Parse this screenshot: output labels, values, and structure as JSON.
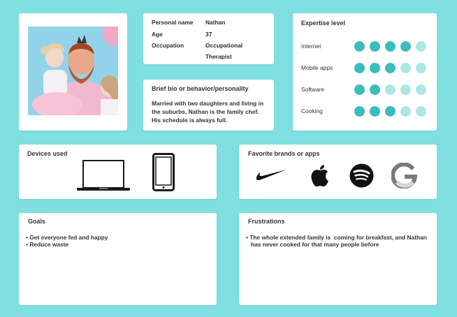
{
  "persona": {
    "name_label": "Personal name",
    "name_value": "Nathan",
    "age_label": "Age",
    "age_value": "37",
    "occupation_label": "Occupation",
    "occupation_value": "Occupational Therapist"
  },
  "bio": {
    "title": "Brief bio or behavior/personality",
    "text": "Married with two daughters and living in the suburbs, Nathan is the family chef. His schedule is always full."
  },
  "expertise": {
    "title": "Expertise level",
    "max": 5,
    "items": [
      {
        "label": "Internet",
        "level": 4
      },
      {
        "label": "Mobile apps",
        "level": 3
      },
      {
        "label": "Software",
        "level": 2
      },
      {
        "label": "Cooking",
        "level": 3
      }
    ],
    "colors": {
      "filled": "#3bbcbd",
      "empty": "#aee6e7"
    }
  },
  "devices": {
    "title": "Devices used",
    "items": [
      "laptop-icon",
      "smartphone-icon"
    ]
  },
  "brands": {
    "title": "Favorite brands or apps",
    "items": [
      "nike-logo-icon",
      "apple-logo-icon",
      "spotify-logo-icon",
      "google-logo-icon"
    ]
  },
  "goals": {
    "title": "Goals",
    "items": [
      "• Get everyone fed and happy",
      "• Reduce waste"
    ]
  },
  "frustrations": {
    "title": "Frustrations",
    "items": [
      "• The whole extended family is  coming for breakfast, and Nathan",
      "has never cooked for that many people before"
    ]
  },
  "colors": {
    "background": "#80dfe0",
    "card": "#ffffff"
  }
}
